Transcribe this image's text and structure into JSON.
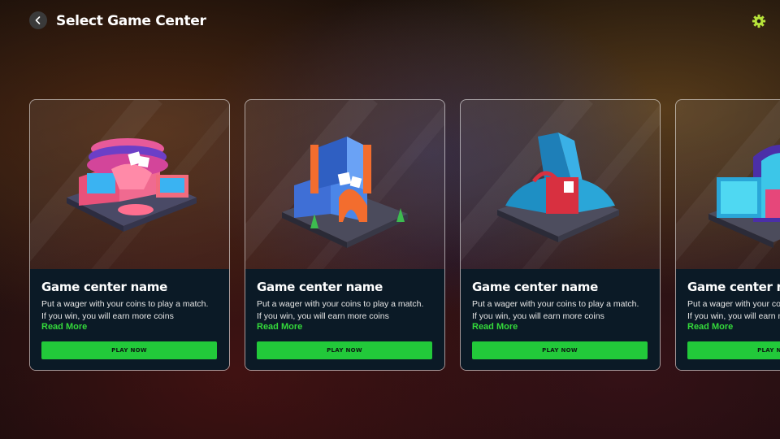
{
  "header": {
    "title": "Select Game Center",
    "back_icon": "chevron-left-icon",
    "settings_icon": "gear-icon",
    "accent_color": "#b6e23a"
  },
  "cards": [
    {
      "name": "Game center name",
      "description_line1": "Put a wager with your coins to play a match.",
      "description_line2": "If you win, you will earn more coins",
      "read_more": "Read More",
      "play": "PLAY NOW",
      "image": "pink-casino-building"
    },
    {
      "name": "Game center name",
      "description_line1": "Put a wager with your coins to play a match.",
      "description_line2": "If you win, you will earn more coins",
      "read_more": "Read More",
      "play": "PLAY NOW",
      "image": "blue-orange-tower-building"
    },
    {
      "name": "Game center name",
      "description_line1": "Put a wager with your coins to play a match.",
      "description_line2": "If you win, you will earn more coins",
      "read_more": "Read More",
      "play": "PLAY NOW",
      "image": "glass-skyscraper-building"
    },
    {
      "name": "Game center name",
      "description_line1": "Put a wager with your coins to play a match.",
      "description_line2": "If you win, you will earn more coins",
      "read_more": "Read More",
      "play": "PLAY NOW",
      "image": "cyan-dome-building"
    }
  ],
  "colors": {
    "play_button": "#22c93a",
    "read_more": "#34d93b",
    "card_info_bg": "#0b1a26"
  }
}
